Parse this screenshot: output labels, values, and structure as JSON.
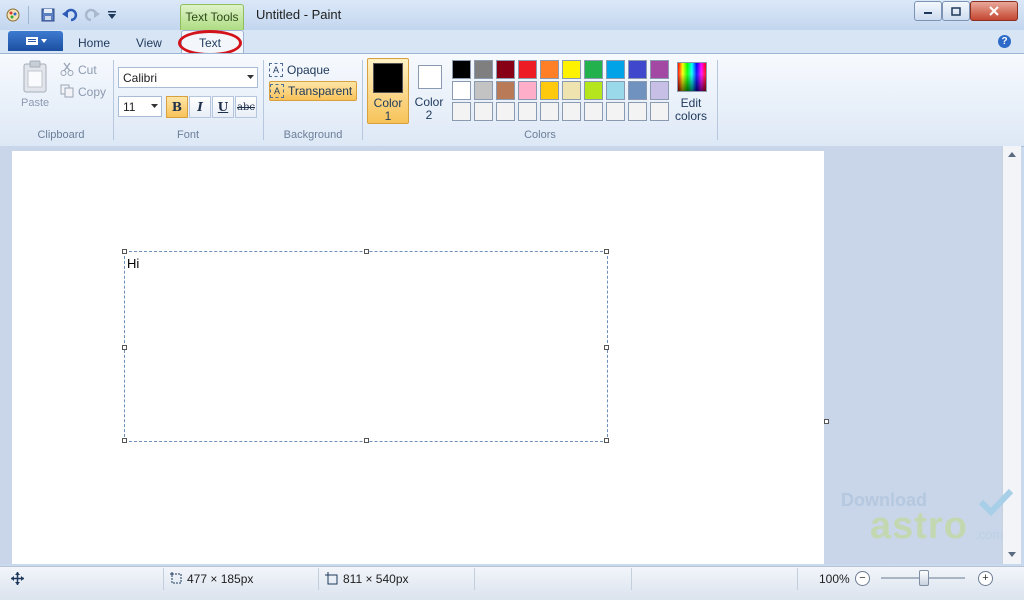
{
  "window": {
    "title": "Untitled - Paint",
    "contextual_tab": "Text Tools"
  },
  "tabs": [
    {
      "label": "Home"
    },
    {
      "label": "View"
    },
    {
      "label": "Text"
    }
  ],
  "clipboard": {
    "paste": "Paste",
    "cut": "Cut",
    "copy": "Copy",
    "label": "Clipboard"
  },
  "font": {
    "family": "Calibri",
    "size": "11",
    "label": "Font",
    "bold": "B",
    "italic": "I",
    "underline": "U",
    "strike": "abc"
  },
  "background": {
    "opaque": "Opaque",
    "transparent": "Transparent",
    "label": "Background"
  },
  "colors": {
    "color1": "Color",
    "color1_num": "1",
    "color2": "Color",
    "color2_num": "2",
    "edit1": "Edit",
    "edit2": "colors",
    "label": "Colors",
    "color1_value": "#000000",
    "color2_value": "#ffffff",
    "row1": [
      "#000000",
      "#7f7f7f",
      "#880015",
      "#ed1c24",
      "#ff7f27",
      "#fff200",
      "#22b14c",
      "#00a2e8",
      "#3f48cc",
      "#a349a4"
    ],
    "row2": [
      "#ffffff",
      "#c3c3c3",
      "#b97a57",
      "#ffaec9",
      "#ffc90e",
      "#efe4b0",
      "#b5e61d",
      "#99d9ea",
      "#7092be",
      "#c8bfe7"
    ],
    "row3": [
      "#f3f3f3",
      "#f3f3f3",
      "#f3f3f3",
      "#f3f3f3",
      "#f3f3f3",
      "#f3f3f3",
      "#f3f3f3",
      "#f3f3f3",
      "#f3f3f3",
      "#f3f3f3"
    ]
  },
  "canvas": {
    "text": "Hi"
  },
  "status": {
    "selection": "477 × 185px",
    "canvas_size": "811 × 540px",
    "zoom": "100%"
  },
  "watermark": {
    "line1": "Download",
    "line2": "astro",
    "line3": ".com"
  }
}
